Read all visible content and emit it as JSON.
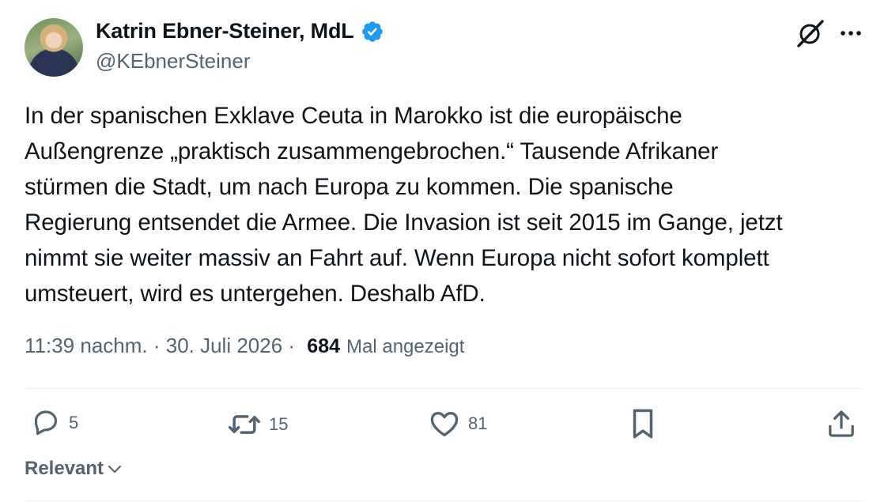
{
  "author": {
    "display_name": "Katrin Ebner-Steiner, MdL",
    "handle": "@KEbnerSteiner",
    "verified": true,
    "verified_color": "#1d9bf0"
  },
  "header_icons": [
    "grok-icon",
    "more-options-icon"
  ],
  "tweet": {
    "lines": [
      "In der spanischen Exklave Ceuta in Marokko ist die europäische",
      "Außengrenze „praktisch zusammengebrochen.“ Tausende Afrikaner",
      "stürmen die Stadt, um nach Europa zu kommen. Die spanische",
      "Regierung entsendet die Armee. Die Invasion ist seit 2015 im Gange, jetzt",
      "nimmt sie weiter massiv an Fahrt auf. Wenn Europa nicht sofort komplett",
      "umsteuert, wird es untergehen. Deshalb AfD."
    ]
  },
  "meta": {
    "time": "11:39 nachm.",
    "separator": " · ",
    "date": "30. Juli 2026",
    "separator2": " · ",
    "views_count": "684",
    "views_label": "Mal angezeigt"
  },
  "actions": {
    "replies": "5",
    "reposts": "15",
    "likes": "81"
  },
  "sort": {
    "label": "Relevant"
  },
  "colors": {
    "text": "#0f1419",
    "secondary": "#536471",
    "divider": "#eff3f4",
    "accent": "#1d9bf0"
  }
}
